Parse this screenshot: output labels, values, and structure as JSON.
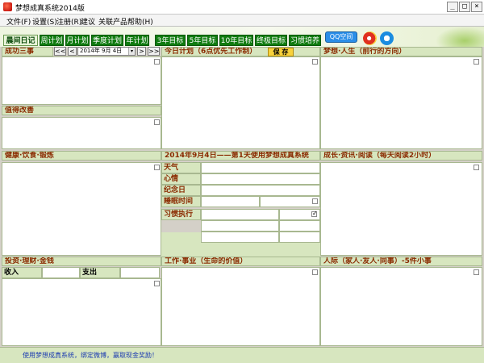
{
  "window": {
    "title": "梦想成真系统2014版",
    "min": "_",
    "max": "□",
    "close": "×"
  },
  "menu": [
    "文件(F)",
    "设置(S)",
    "注册(R)",
    "建议",
    "关联产品",
    "帮助(H)"
  ],
  "tabs": [
    "晨间日记",
    "周计划",
    "月计划",
    "季度计划",
    "年计划",
    "3年目标",
    "5年目标",
    "10年目标",
    "终极目标",
    "习惯培养"
  ],
  "icons": {
    "qq_label": "QQ空间"
  },
  "nav": {
    "first": "<<",
    "prev": "<",
    "next": ">",
    "last": ">>",
    "date": "2014年 9月 4日",
    "date_dropdown": "▾"
  },
  "panels": {
    "success": "成功三事",
    "improve": "值得改善",
    "today_plan": "今日计划（6点优先工作制）",
    "save": "保 存",
    "dream": "梦想·人生（前行的方向）",
    "health": "健康·饮食·锻炼",
    "diary_head": "2014年9月4日——第1天使用梦想成真系统",
    "growth": "成长·资讯·阅读（每天阅读2小时）",
    "invest": "投资·理财·金钱",
    "work": "工作·事业（生命的价值）",
    "relations": "人际（家人·友人·同事）-5件小事"
  },
  "diary_fields": [
    "天气",
    "心情",
    "纪念日",
    "睡眠时间",
    "习惯执行"
  ],
  "money": {
    "income": "收入",
    "expense": "支出"
  },
  "status": {
    "message": "使用梦想成真系统，绑定微博，赢取现金奖励！"
  },
  "colors": {
    "tab_green": "#0f7b0f",
    "panel_header": "#d7e6bf",
    "header_text": "#8a2a00",
    "save_button": "#f8d23c"
  }
}
